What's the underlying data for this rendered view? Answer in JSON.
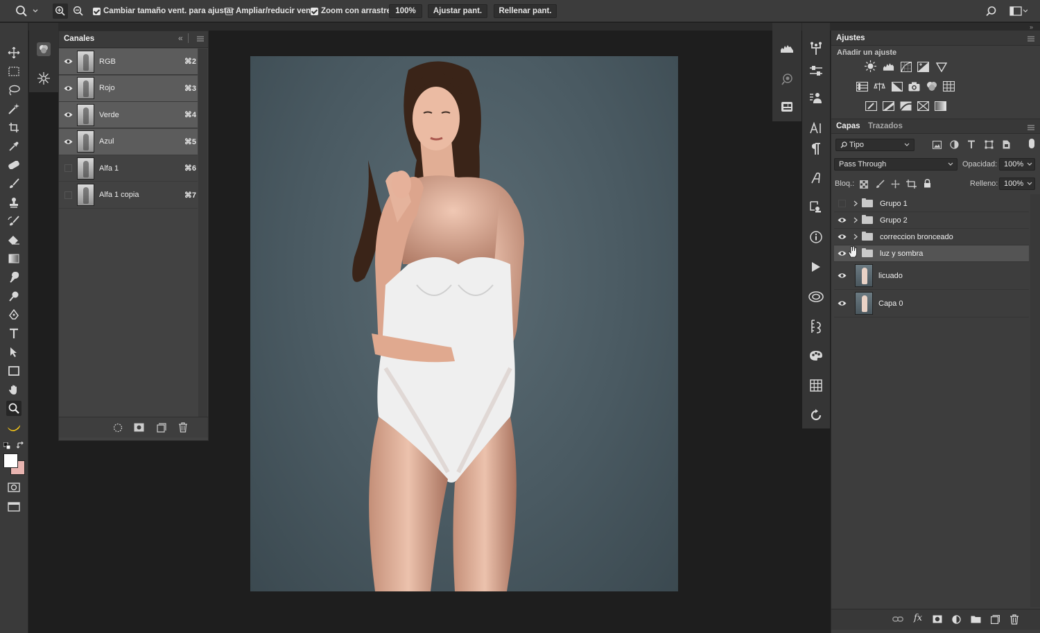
{
  "optionsbar": {
    "resize_windows": "Cambiar tamaño vent. para ajustar",
    "zoom_all": "Ampliar/reducir vent.",
    "scrubby_zoom": "Zoom con arrastre",
    "zoom_value": "100%",
    "fit_screen": "Ajustar pant.",
    "fill_screen": "Rellenar pant."
  },
  "channels": {
    "title": "Canales",
    "rows": [
      {
        "name": "RGB",
        "key": "⌘2",
        "visible": true,
        "selected": true
      },
      {
        "name": "Rojo",
        "key": "⌘3",
        "visible": true,
        "selected": true
      },
      {
        "name": "Verde",
        "key": "⌘4",
        "visible": true,
        "selected": true
      },
      {
        "name": "Azul",
        "key": "⌘5",
        "visible": true,
        "selected": true
      },
      {
        "name": "Alfa 1",
        "key": "⌘6",
        "visible": false,
        "selected": false
      },
      {
        "name": "Alfa 1 copia",
        "key": "⌘7",
        "visible": false,
        "selected": false
      }
    ]
  },
  "adjustments": {
    "title": "Ajustes",
    "subtitle": "Añadir un ajuste"
  },
  "layers": {
    "tabs": [
      "Capas",
      "Trazados"
    ],
    "filter": "Tipo",
    "blend_mode": "Pass Through",
    "opacity_label": "Opacidad:",
    "opacity_value": "100%",
    "lock_label": "Bloq.:",
    "fill_label": "Relleno:",
    "fill_value": "100%",
    "items": [
      {
        "name": "Grupo 1",
        "type": "group",
        "visible": false
      },
      {
        "name": "Grupo 2",
        "type": "group",
        "visible": true
      },
      {
        "name": "correccion bronceado",
        "type": "group",
        "visible": true
      },
      {
        "name": "luz y sombra",
        "type": "group",
        "visible": true,
        "selected": true
      },
      {
        "name": "licuado",
        "type": "layer",
        "visible": true
      },
      {
        "name": "Capa 0",
        "type": "layer",
        "visible": true
      }
    ],
    "footer_fx": "fx"
  },
  "colors": {
    "foreground": "#ffffff",
    "background": "#e8b4b0",
    "canvas_backdrop": "#4e5f67"
  }
}
